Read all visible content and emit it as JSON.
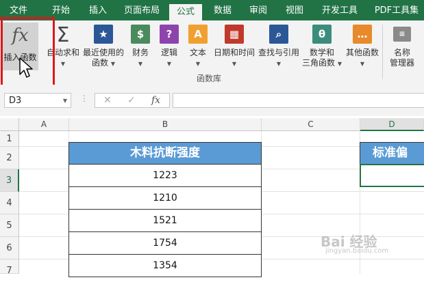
{
  "tabs": [
    {
      "label": "文件"
    },
    {
      "label": "开始"
    },
    {
      "label": "插入"
    },
    {
      "label": "页面布局"
    },
    {
      "label": "公式"
    },
    {
      "label": "数据"
    },
    {
      "label": "审阅"
    },
    {
      "label": "视图"
    },
    {
      "label": "开发工具"
    },
    {
      "label": "PDF工具集"
    }
  ],
  "ribbon": {
    "insert_function": "插入函数",
    "autosum": "自动求和",
    "recent_line1": "最近使用的",
    "recent_line2": "函数",
    "financial": "财务",
    "logical": "逻辑",
    "text": "文本",
    "datetime": "日期和时间",
    "lookup": "查找与引用",
    "math_line1": "数学和",
    "math_line2": "三角函数",
    "other": "其他函数",
    "name_mgr_line1": "名称",
    "name_mgr_line2": "管理器",
    "group_label": "函数库",
    "colors": {
      "blue": "#2b5797",
      "green": "#4a8a5c",
      "purple": "#8e44ad",
      "orange": "#f0a030",
      "red": "#c0392b",
      "teal": "#3c8c7c",
      "lightorange": "#e8892b"
    }
  },
  "formula_bar": {
    "name_box": "D3",
    "cancel": "✕",
    "enter": "✓",
    "fx": "fx",
    "formula": ""
  },
  "sheet": {
    "columns": [
      "A",
      "B",
      "C",
      "D"
    ],
    "rows": [
      "1",
      "2",
      "3",
      "4",
      "5",
      "6",
      "7"
    ],
    "header_b": "木料抗断强度",
    "header_d": "标准偏",
    "values": [
      "1223",
      "1210",
      "1521",
      "1754",
      "1354"
    ]
  },
  "watermark": {
    "main": "Bai 经验",
    "sub": "jingyan.baidu.com"
  }
}
